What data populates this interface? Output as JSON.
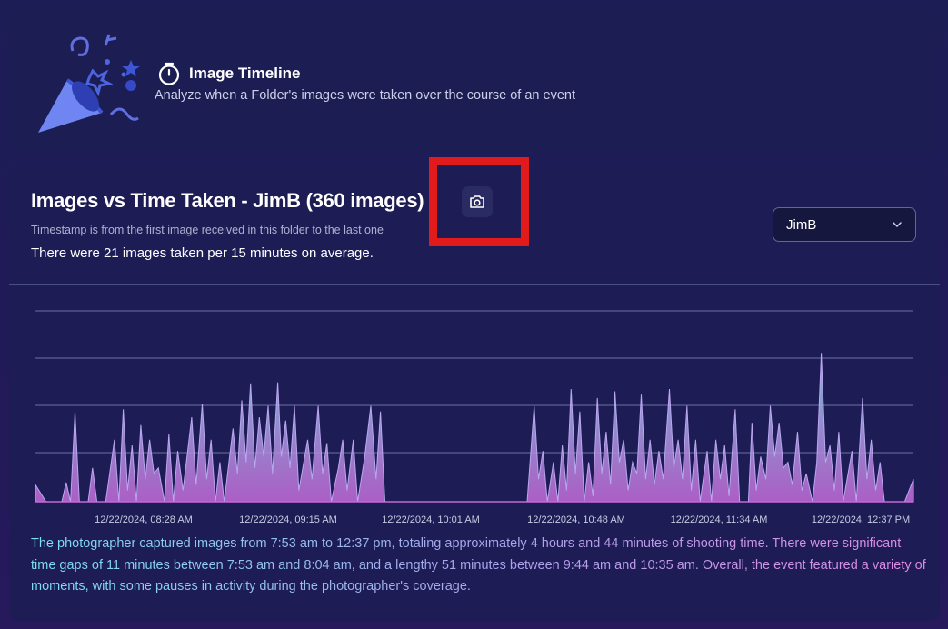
{
  "header": {
    "icon": "stopwatch-icon",
    "title": "Image Timeline",
    "subtitle": "Analyze when a Folder's images were taken over the course of an event",
    "illustration": "party-popper-icon"
  },
  "chart_panel": {
    "title": "Images vs Time Taken - JimB (360 images)",
    "camera_button_icon": "camera-icon",
    "timestamp_note": "Timestamp is from the first image received in this folder to the last one",
    "average_note": "There were 21 images taken per 15 minutes on average.",
    "photographer_select": {
      "value": "JimB",
      "icon": "chevron-down-icon"
    },
    "summary": "The photographer captured images from 7:53 am to 12:37 pm, totaling approximately 4 hours and 44 minutes of shooting time. There were significant time gaps of 11 minutes between 7:53 am and 8:04 am, and a lengthy 51 minutes between 9:44 am and 10:35 am. Overall, the event featured a variety of moments, with some pauses in activity during the photographer's coverage."
  },
  "chart_data": {
    "type": "area",
    "title": "",
    "xlabel": "",
    "ylabel": "",
    "x_tick_labels": [
      "12/22/2024, 08:28 AM",
      "12/22/2024, 09:15 AM",
      "12/22/2024, 10:01 AM",
      "12/22/2024, 10:48 AM",
      "12/22/2024, 11:34 AM",
      "12/22/2024, 12:37 PM"
    ],
    "x_range": [
      "7:53 AM",
      "12:37 PM"
    ],
    "grid": "horizontal",
    "colors": {
      "top": "#8ed1ee",
      "bottom": "#c46ad8",
      "stroke": "#b9a7ef"
    },
    "spikes": [
      [
        0.0,
        0.15
      ],
      [
        0.012,
        0.0
      ],
      [
        0.03,
        0.0
      ],
      [
        0.035,
        0.17
      ],
      [
        0.04,
        0.0
      ],
      [
        0.045,
        0.8
      ],
      [
        0.05,
        0.0
      ],
      [
        0.06,
        0.0
      ],
      [
        0.065,
        0.3
      ],
      [
        0.07,
        0.0
      ],
      [
        0.08,
        0.0
      ],
      [
        0.09,
        0.55
      ],
      [
        0.095,
        0.0
      ],
      [
        0.1,
        0.82
      ],
      [
        0.105,
        0.1
      ],
      [
        0.11,
        0.5
      ],
      [
        0.115,
        0.0
      ],
      [
        0.12,
        0.68
      ],
      [
        0.125,
        0.2
      ],
      [
        0.13,
        0.55
      ],
      [
        0.135,
        0.25
      ],
      [
        0.14,
        0.3
      ],
      [
        0.147,
        0.0
      ],
      [
        0.152,
        0.6
      ],
      [
        0.157,
        0.0
      ],
      [
        0.162,
        0.45
      ],
      [
        0.168,
        0.1
      ],
      [
        0.178,
        0.75
      ],
      [
        0.183,
        0.15
      ],
      [
        0.19,
        0.87
      ],
      [
        0.195,
        0.2
      ],
      [
        0.2,
        0.55
      ],
      [
        0.205,
        0.0
      ],
      [
        0.21,
        0.35
      ],
      [
        0.215,
        0.0
      ],
      [
        0.225,
        0.65
      ],
      [
        0.23,
        0.25
      ],
      [
        0.235,
        0.9
      ],
      [
        0.24,
        0.35
      ],
      [
        0.245,
        1.05
      ],
      [
        0.25,
        0.3
      ],
      [
        0.255,
        0.75
      ],
      [
        0.26,
        0.4
      ],
      [
        0.265,
        0.85
      ],
      [
        0.27,
        0.25
      ],
      [
        0.276,
        1.06
      ],
      [
        0.28,
        0.4
      ],
      [
        0.285,
        0.72
      ],
      [
        0.29,
        0.3
      ],
      [
        0.295,
        0.85
      ],
      [
        0.3,
        0.1
      ],
      [
        0.31,
        0.55
      ],
      [
        0.315,
        0.2
      ],
      [
        0.322,
        0.85
      ],
      [
        0.327,
        0.25
      ],
      [
        0.332,
        0.52
      ],
      [
        0.337,
        0.0
      ],
      [
        0.345,
        0.3
      ],
      [
        0.35,
        0.55
      ],
      [
        0.355,
        0.1
      ],
      [
        0.362,
        0.55
      ],
      [
        0.367,
        0.0
      ],
      [
        0.375,
        0.4
      ],
      [
        0.382,
        0.85
      ],
      [
        0.388,
        0.2
      ],
      [
        0.393,
        0.8
      ],
      [
        0.398,
        0.0
      ],
      [
        0.405,
        0.0
      ],
      [
        0.41,
        0.0
      ],
      [
        0.55,
        0.0
      ],
      [
        0.56,
        0.0
      ],
      [
        0.568,
        0.85
      ],
      [
        0.573,
        0.2
      ],
      [
        0.578,
        0.45
      ],
      [
        0.583,
        0.0
      ],
      [
        0.59,
        0.35
      ],
      [
        0.595,
        0.0
      ],
      [
        0.6,
        0.5
      ],
      [
        0.605,
        0.1
      ],
      [
        0.61,
        1.0
      ],
      [
        0.615,
        0.25
      ],
      [
        0.62,
        0.8
      ],
      [
        0.625,
        0.0
      ],
      [
        0.63,
        0.35
      ],
      [
        0.635,
        0.05
      ],
      [
        0.64,
        0.92
      ],
      [
        0.645,
        0.25
      ],
      [
        0.65,
        0.62
      ],
      [
        0.655,
        0.15
      ],
      [
        0.66,
        0.98
      ],
      [
        0.665,
        0.35
      ],
      [
        0.67,
        0.55
      ],
      [
        0.675,
        0.1
      ],
      [
        0.68,
        0.35
      ],
      [
        0.685,
        0.25
      ],
      [
        0.69,
        0.95
      ],
      [
        0.695,
        0.2
      ],
      [
        0.7,
        0.55
      ],
      [
        0.705,
        0.15
      ],
      [
        0.71,
        0.45
      ],
      [
        0.715,
        0.2
      ],
      [
        0.722,
        1.0
      ],
      [
        0.727,
        0.3
      ],
      [
        0.732,
        0.55
      ],
      [
        0.737,
        0.2
      ],
      [
        0.742,
        0.85
      ],
      [
        0.747,
        0.1
      ],
      [
        0.752,
        0.55
      ],
      [
        0.757,
        0.0
      ],
      [
        0.765,
        0.45
      ],
      [
        0.77,
        0.0
      ],
      [
        0.775,
        0.55
      ],
      [
        0.78,
        0.2
      ],
      [
        0.785,
        0.5
      ],
      [
        0.79,
        0.05
      ],
      [
        0.797,
        0.82
      ],
      [
        0.802,
        0.0
      ],
      [
        0.812,
        0.0
      ],
      [
        0.816,
        0.7
      ],
      [
        0.821,
        0.1
      ],
      [
        0.826,
        0.4
      ],
      [
        0.832,
        0.2
      ],
      [
        0.837,
        0.85
      ],
      [
        0.842,
        0.4
      ],
      [
        0.847,
        0.7
      ],
      [
        0.852,
        0.3
      ],
      [
        0.857,
        0.35
      ],
      [
        0.862,
        0.15
      ],
      [
        0.868,
        0.62
      ],
      [
        0.873,
        0.1
      ],
      [
        0.878,
        0.25
      ],
      [
        0.885,
        0.0
      ],
      [
        0.89,
        0.35
      ],
      [
        0.895,
        1.32
      ],
      [
        0.9,
        0.35
      ],
      [
        0.905,
        0.5
      ],
      [
        0.91,
        0.1
      ],
      [
        0.915,
        0.62
      ],
      [
        0.92,
        0.0
      ],
      [
        0.93,
        0.45
      ],
      [
        0.935,
        0.0
      ],
      [
        0.942,
        0.92
      ],
      [
        0.947,
        0.2
      ],
      [
        0.952,
        0.55
      ],
      [
        0.957,
        0.1
      ],
      [
        0.962,
        0.35
      ],
      [
        0.967,
        0.0
      ],
      [
        0.975,
        0.0
      ],
      [
        0.98,
        0.0
      ],
      [
        0.99,
        0.0
      ],
      [
        1.0,
        0.2
      ]
    ]
  }
}
